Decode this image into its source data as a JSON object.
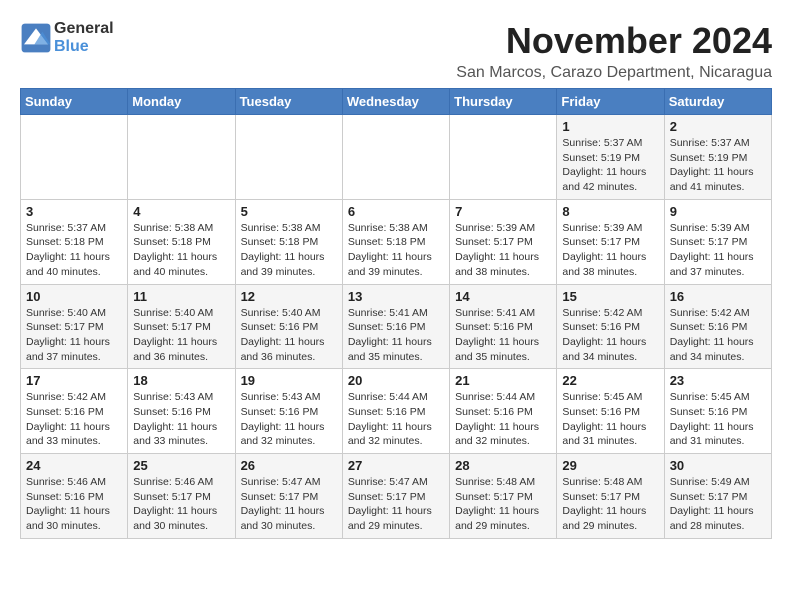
{
  "header": {
    "logo_general": "General",
    "logo_blue": "Blue",
    "month_title": "November 2024",
    "location": "San Marcos, Carazo Department, Nicaragua"
  },
  "weekdays": [
    "Sunday",
    "Monday",
    "Tuesday",
    "Wednesday",
    "Thursday",
    "Friday",
    "Saturday"
  ],
  "weeks": [
    [
      {
        "day": "",
        "info": ""
      },
      {
        "day": "",
        "info": ""
      },
      {
        "day": "",
        "info": ""
      },
      {
        "day": "",
        "info": ""
      },
      {
        "day": "",
        "info": ""
      },
      {
        "day": "1",
        "info": "Sunrise: 5:37 AM\nSunset: 5:19 PM\nDaylight: 11 hours\nand 42 minutes."
      },
      {
        "day": "2",
        "info": "Sunrise: 5:37 AM\nSunset: 5:19 PM\nDaylight: 11 hours\nand 41 minutes."
      }
    ],
    [
      {
        "day": "3",
        "info": "Sunrise: 5:37 AM\nSunset: 5:18 PM\nDaylight: 11 hours\nand 40 minutes."
      },
      {
        "day": "4",
        "info": "Sunrise: 5:38 AM\nSunset: 5:18 PM\nDaylight: 11 hours\nand 40 minutes."
      },
      {
        "day": "5",
        "info": "Sunrise: 5:38 AM\nSunset: 5:18 PM\nDaylight: 11 hours\nand 39 minutes."
      },
      {
        "day": "6",
        "info": "Sunrise: 5:38 AM\nSunset: 5:18 PM\nDaylight: 11 hours\nand 39 minutes."
      },
      {
        "day": "7",
        "info": "Sunrise: 5:39 AM\nSunset: 5:17 PM\nDaylight: 11 hours\nand 38 minutes."
      },
      {
        "day": "8",
        "info": "Sunrise: 5:39 AM\nSunset: 5:17 PM\nDaylight: 11 hours\nand 38 minutes."
      },
      {
        "day": "9",
        "info": "Sunrise: 5:39 AM\nSunset: 5:17 PM\nDaylight: 11 hours\nand 37 minutes."
      }
    ],
    [
      {
        "day": "10",
        "info": "Sunrise: 5:40 AM\nSunset: 5:17 PM\nDaylight: 11 hours\nand 37 minutes."
      },
      {
        "day": "11",
        "info": "Sunrise: 5:40 AM\nSunset: 5:17 PM\nDaylight: 11 hours\nand 36 minutes."
      },
      {
        "day": "12",
        "info": "Sunrise: 5:40 AM\nSunset: 5:16 PM\nDaylight: 11 hours\nand 36 minutes."
      },
      {
        "day": "13",
        "info": "Sunrise: 5:41 AM\nSunset: 5:16 PM\nDaylight: 11 hours\nand 35 minutes."
      },
      {
        "day": "14",
        "info": "Sunrise: 5:41 AM\nSunset: 5:16 PM\nDaylight: 11 hours\nand 35 minutes."
      },
      {
        "day": "15",
        "info": "Sunrise: 5:42 AM\nSunset: 5:16 PM\nDaylight: 11 hours\nand 34 minutes."
      },
      {
        "day": "16",
        "info": "Sunrise: 5:42 AM\nSunset: 5:16 PM\nDaylight: 11 hours\nand 34 minutes."
      }
    ],
    [
      {
        "day": "17",
        "info": "Sunrise: 5:42 AM\nSunset: 5:16 PM\nDaylight: 11 hours\nand 33 minutes."
      },
      {
        "day": "18",
        "info": "Sunrise: 5:43 AM\nSunset: 5:16 PM\nDaylight: 11 hours\nand 33 minutes."
      },
      {
        "day": "19",
        "info": "Sunrise: 5:43 AM\nSunset: 5:16 PM\nDaylight: 11 hours\nand 32 minutes."
      },
      {
        "day": "20",
        "info": "Sunrise: 5:44 AM\nSunset: 5:16 PM\nDaylight: 11 hours\nand 32 minutes."
      },
      {
        "day": "21",
        "info": "Sunrise: 5:44 AM\nSunset: 5:16 PM\nDaylight: 11 hours\nand 32 minutes."
      },
      {
        "day": "22",
        "info": "Sunrise: 5:45 AM\nSunset: 5:16 PM\nDaylight: 11 hours\nand 31 minutes."
      },
      {
        "day": "23",
        "info": "Sunrise: 5:45 AM\nSunset: 5:16 PM\nDaylight: 11 hours\nand 31 minutes."
      }
    ],
    [
      {
        "day": "24",
        "info": "Sunrise: 5:46 AM\nSunset: 5:16 PM\nDaylight: 11 hours\nand 30 minutes."
      },
      {
        "day": "25",
        "info": "Sunrise: 5:46 AM\nSunset: 5:17 PM\nDaylight: 11 hours\nand 30 minutes."
      },
      {
        "day": "26",
        "info": "Sunrise: 5:47 AM\nSunset: 5:17 PM\nDaylight: 11 hours\nand 30 minutes."
      },
      {
        "day": "27",
        "info": "Sunrise: 5:47 AM\nSunset: 5:17 PM\nDaylight: 11 hours\nand 29 minutes."
      },
      {
        "day": "28",
        "info": "Sunrise: 5:48 AM\nSunset: 5:17 PM\nDaylight: 11 hours\nand 29 minutes."
      },
      {
        "day": "29",
        "info": "Sunrise: 5:48 AM\nSunset: 5:17 PM\nDaylight: 11 hours\nand 29 minutes."
      },
      {
        "day": "30",
        "info": "Sunrise: 5:49 AM\nSunset: 5:17 PM\nDaylight: 11 hours\nand 28 minutes."
      }
    ]
  ]
}
